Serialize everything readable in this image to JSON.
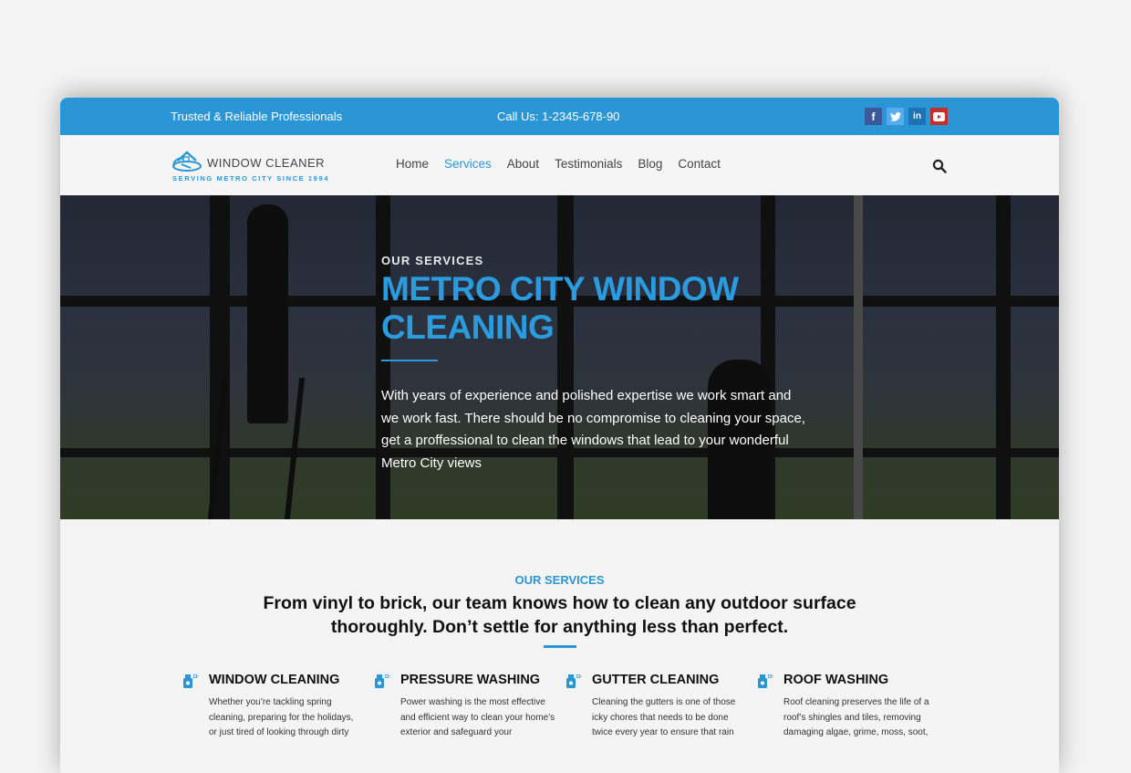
{
  "topbar": {
    "tagline": "Trusted & Reliable Professionals",
    "phone": "Call Us: 1-2345-678-90",
    "socials": [
      {
        "name": "facebook",
        "glyph": "f",
        "color": "#3b5998"
      },
      {
        "name": "twitter",
        "glyph": "t",
        "color": "#55acee"
      },
      {
        "name": "linkedin",
        "glyph": "in",
        "color": "#1e73b5"
      },
      {
        "name": "youtube",
        "glyph": "▶",
        "color": "#c4302b"
      }
    ]
  },
  "logo": {
    "name": "WINDOW CLEANER",
    "tagline": "SERVING METRO CITY SINCE 1994"
  },
  "nav": {
    "items": [
      {
        "label": "Home",
        "active": false
      },
      {
        "label": "Services",
        "active": true
      },
      {
        "label": "About",
        "active": false
      },
      {
        "label": "Testimonials",
        "active": false
      },
      {
        "label": "Blog",
        "active": false
      },
      {
        "label": "Contact",
        "active": false
      }
    ],
    "search_icon": "search-icon"
  },
  "hero": {
    "eyebrow": "OUR SERVICES",
    "title": "METRO CITY WINDOW CLEANING",
    "body": "With years of experience and polished expertise we work smart and we work fast. There should be no compromise to cleaning your space, get a proffessional to clean the windows that lead to your wonderful Metro City views"
  },
  "services": {
    "eyebrow": "OUR SERVICES",
    "heading": "From vinyl to brick, our team knows how to clean any outdoor surface thoroughly. Don’t settle for anything less than perfect.",
    "items": [
      {
        "title": "WINDOW CLEANING",
        "text": "Whether you’re tackling spring cleaning, preparing for the holidays, or just tired of looking through dirty",
        "icon": "spray-bottle-icon"
      },
      {
        "title": "PRESSURE WASHING",
        "text": "Power washing is the most effective and efficient way to clean your home’s exterior and safeguard your",
        "icon": "spray-bottle-icon"
      },
      {
        "title": "GUTTER CLEANING",
        "text": "Cleaning the gutters is one of those icky chores that needs to be done twice every year to ensure that rain",
        "icon": "spray-bottle-icon"
      },
      {
        "title": "ROOF WASHING",
        "text": "Roof cleaning preserves the life of a roof’s shingles and tiles, removing damaging algae, grime, moss, soot,",
        "icon": "spray-bottle-icon"
      }
    ]
  },
  "colors": {
    "brand_blue": "#2b96d6",
    "hero_title": "#2b9be0"
  }
}
